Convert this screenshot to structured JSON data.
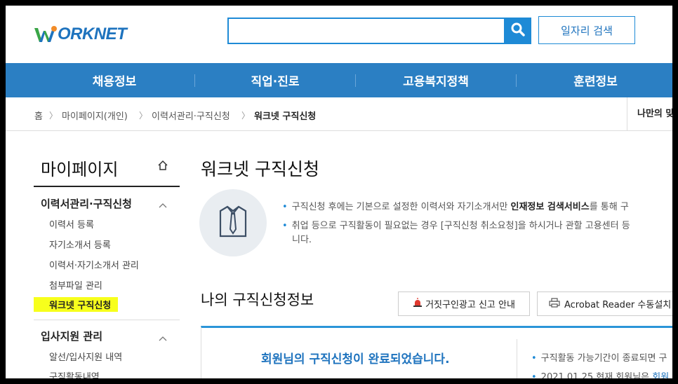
{
  "header": {
    "logo_text": "ORKNET",
    "search_placeholder": "",
    "job_search_label": "일자리 검색",
    "search_icon": "search-icon"
  },
  "gnb": {
    "items": [
      {
        "label": "채용정보"
      },
      {
        "label": "직업·진로"
      },
      {
        "label": "고용복지정책"
      },
      {
        "label": "훈련정보"
      }
    ]
  },
  "breadcrumb": {
    "home": "홈",
    "items": [
      "마이페이지(개인)",
      "이력서관리·구직신청",
      "워크넷 구직신청"
    ],
    "my_menu": "나만의 맞"
  },
  "sidebar": {
    "title": "마이페이지",
    "groups": [
      {
        "label": "이력서관리·구직신청",
        "items": [
          "이력서 등록",
          "자기소개서 등록",
          "이력서·자기소개서 관리",
          "첨부파일 관리",
          "워크넷 구직신청"
        ]
      },
      {
        "label": "입사지원 관리",
        "items": [
          "알선/입사지원 내역",
          "구직활동내역"
        ]
      }
    ]
  },
  "main": {
    "title": "워크넷 구직신청",
    "info": {
      "line1_prefix": "구직신청 후에는 기본으로 설정한 이력서와 자기소개서만 ",
      "line1_bold": "인재정보 검색서비스",
      "line1_suffix": "를 통해 구",
      "line2": "취업 등으로 구직활동이 필요없는 경우 [구직신청 취소요청]을 하시거나 관할 고용센터 등",
      "line3": "니다."
    },
    "section_title": "나의 구직신청정보",
    "report_button": "거짓구인광고 신고 안내",
    "acrobat_button": "Acrobat Reader 수동설치",
    "status_message": "회원님의 구직신청이 완료되었습니다.",
    "notes": {
      "note1": "구직활동 가능기간이 종료되면 구",
      "note2_prefix": "2021.01.25 현재 회원님은 ",
      "note2_link": "회원"
    }
  },
  "colors": {
    "brand_blue": "#2b7fc3",
    "accent_blue": "#1e8ad6",
    "highlight_yellow": "#f7ff1c"
  }
}
